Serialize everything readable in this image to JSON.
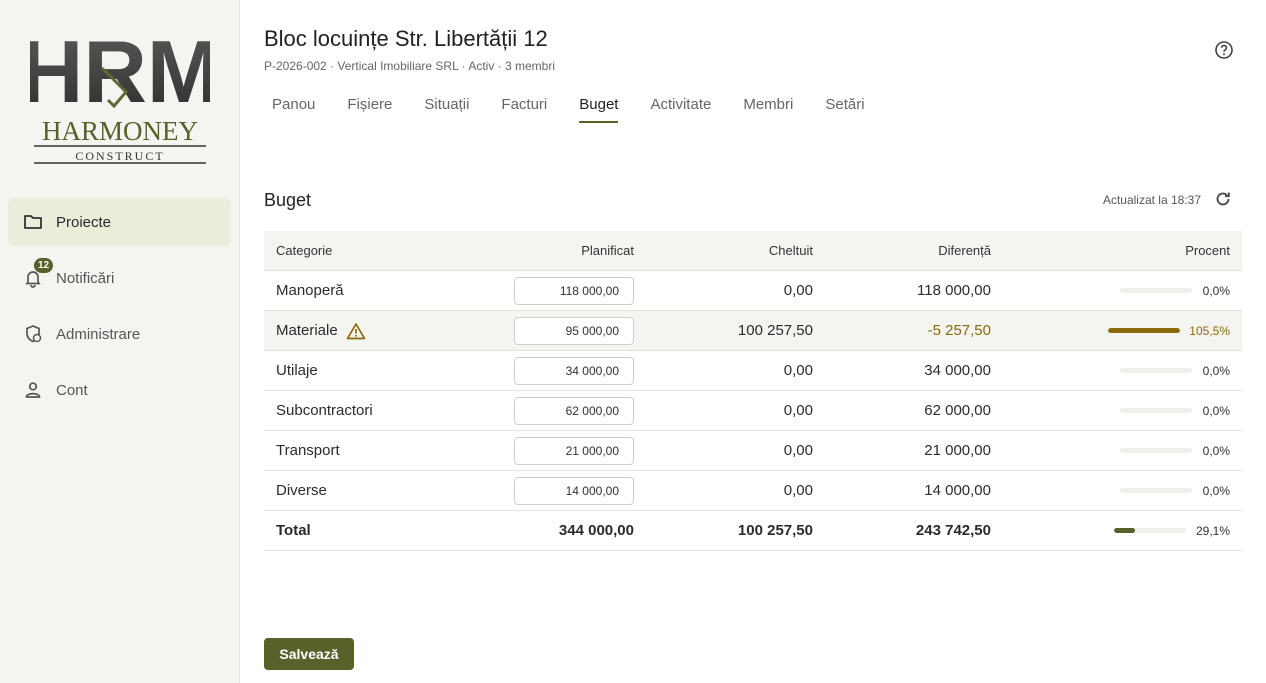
{
  "brand": {
    "logo_main": "HRM",
    "logo_name": "HARMONEY",
    "logo_sub": "CONSTRUCT",
    "accent": "#59602a",
    "warn": "#8a6a0a"
  },
  "sidebar": {
    "items": [
      {
        "label": "Proiecte",
        "icon": "folder-icon",
        "active": true
      },
      {
        "label": "Notificări",
        "icon": "bell-icon",
        "badge": "12"
      },
      {
        "label": "Administrare",
        "icon": "admin-shield-icon"
      },
      {
        "label": "Cont",
        "icon": "person-icon"
      }
    ]
  },
  "project": {
    "title": "Bloc locuințe Str. Libertății 12",
    "subtitle": "P-2026-002 · Vertical Imobiliare SRL · Activ · 3 membri"
  },
  "tabs": [
    {
      "label": "Panou"
    },
    {
      "label": "Fișiere"
    },
    {
      "label": "Situații"
    },
    {
      "label": "Facturi"
    },
    {
      "label": "Buget",
      "active": true
    },
    {
      "label": "Activitate"
    },
    {
      "label": "Membri"
    },
    {
      "label": "Setări"
    }
  ],
  "budget": {
    "title": "Buget",
    "updated": "Actualizat la 18:37",
    "headers": {
      "category": "Categorie",
      "planned": "Planificat",
      "spent": "Cheltuit",
      "diff": "Diferență",
      "percent": "Procent"
    },
    "rows": [
      {
        "category": "Manoperă",
        "planned": "118 000,00",
        "spent": "0,00",
        "diff": "118 000,00",
        "percent": "0,0%",
        "pct": 0
      },
      {
        "category": "Materiale",
        "planned": "95 000,00",
        "spent": "100 257,50",
        "diff": "-5 257,50",
        "percent": "105,5%",
        "pct": 105.5,
        "warning": true
      },
      {
        "category": "Utilaje",
        "planned": "34 000,00",
        "spent": "0,00",
        "diff": "34 000,00",
        "percent": "0,0%",
        "pct": 0
      },
      {
        "category": "Subcontractori",
        "planned": "62 000,00",
        "spent": "0,00",
        "diff": "62 000,00",
        "percent": "0,0%",
        "pct": 0
      },
      {
        "category": "Transport",
        "planned": "21 000,00",
        "spent": "0,00",
        "diff": "21 000,00",
        "percent": "0,0%",
        "pct": 0
      },
      {
        "category": "Diverse",
        "planned": "14 000,00",
        "spent": "0,00",
        "diff": "14 000,00",
        "percent": "0,0%",
        "pct": 0
      }
    ],
    "total": {
      "category": "Total",
      "planned": "344 000,00",
      "spent": "100 257,50",
      "diff": "243 742,50",
      "percent": "29,1%",
      "pct": 29.1
    },
    "save_label": "Salvează"
  }
}
